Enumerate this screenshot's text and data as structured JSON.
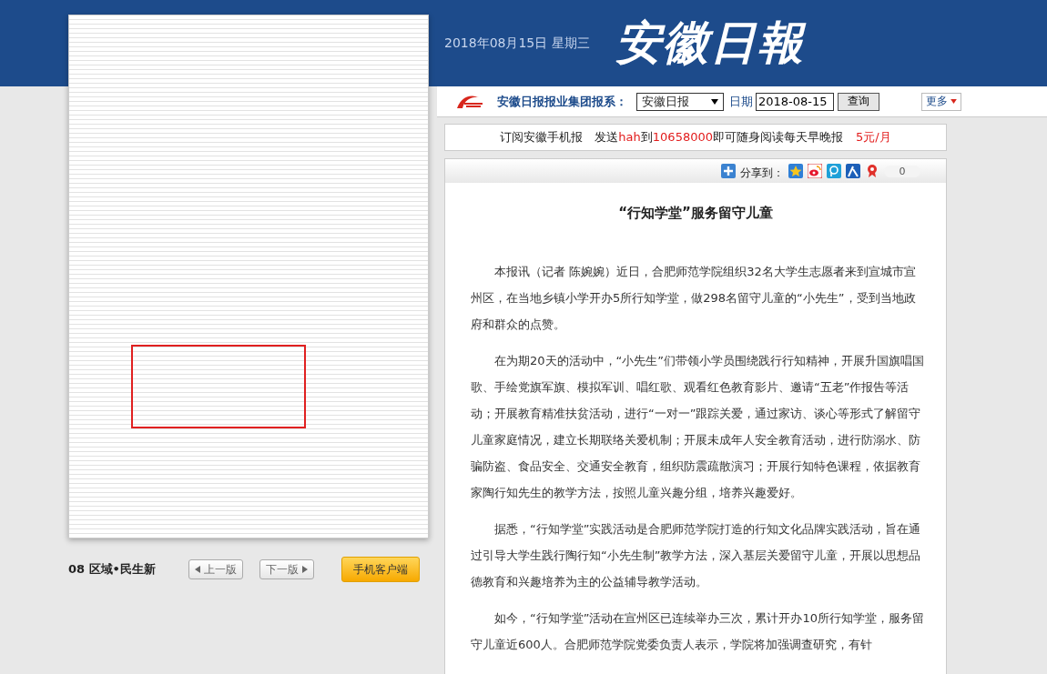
{
  "header": {
    "date": "2018年08月15日 星期三",
    "logo": "安徽日報"
  },
  "toolbar": {
    "label": "安徽日报报业集团报系：",
    "select_value": "安徽日报",
    "date_label": "日期",
    "date_value": "2018-08-15",
    "query_button": "查询",
    "more_button": "更多"
  },
  "subscription": {
    "segments": [
      {
        "text": "订阅安徽手机报　发送",
        "highlight": false
      },
      {
        "text": "hah",
        "highlight": true
      },
      {
        "text": "到",
        "highlight": false
      },
      {
        "text": "10658000",
        "highlight": true
      },
      {
        "text": "即可随身阅读每天早晚报",
        "highlight": false
      }
    ],
    "price": "5元/月"
  },
  "share": {
    "label": "分享到：",
    "count": "0"
  },
  "article": {
    "title": "“行知学堂”服务留守儿童",
    "paragraphs": [
      "本报讯（记者 陈婉婉）近日，合肥师范学院组织32名大学生志愿者来到宣城市宣州区，在当地乡镇小学开办5所行知学堂，做298名留守儿童的“小先生”，受到当地政府和群众的点赞。",
      "在为期20天的活动中，“小先生”们带领小学员围绕践行行知精神，开展升国旗唱国歌、手绘党旗军旗、模拟军训、唱红歌、观看红色教育影片、邀请“五老”作报告等活动；开展教育精准扶贫活动，进行“一对一”跟踪关爱，通过家访、谈心等形式了解留守儿童家庭情况，建立长期联络关爱机制；开展未成年人安全教育活动，进行防溺水、防骗防盗、食品安全、交通安全教育，组织防震疏散演习；开展行知特色课程，依据教育家陶行知先生的教学方法，按照儿童兴趣分组，培养兴趣爱好。",
      "据悉，“行知学堂”实践活动是合肥师范学院打造的行知文化品牌实践活动，旨在通过引导大学生践行陶行知“小先生制”教学方法，深入基层关爱留守儿童，开展以思想品德教育和兴趣培养为主的公益辅导教学活动。",
      "如今，“行知学堂”活动在宣州区已连续举办三次，累计开办10所行知学堂，服务留守儿童近600人。合肥师范学院党委负责人表示，学院将加强调查研究，有针"
    ]
  },
  "page_nav": {
    "page_name": "08 区域•民生新",
    "prev_button": "上一版",
    "next_button": "下一版",
    "app_button": "手机客户端"
  }
}
